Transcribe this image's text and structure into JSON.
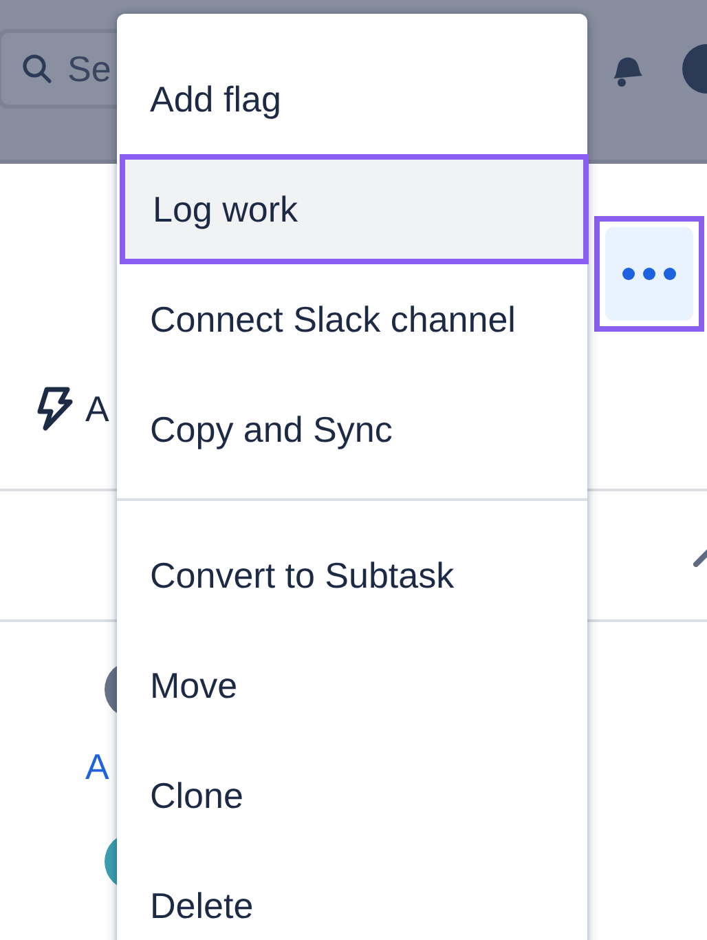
{
  "header": {
    "search": {
      "placeholder": "Se"
    }
  },
  "more_button": {
    "highlighted": true
  },
  "field_row": {
    "label": "A"
  },
  "activity": [
    {
      "color": "#687388"
    },
    {
      "color": "#3f9fb3"
    }
  ],
  "activity_link": "A",
  "menu": {
    "groups": [
      [
        {
          "label": "Add flag",
          "highlighted": false
        },
        {
          "label": "Log work",
          "highlighted": true
        },
        {
          "label": "Connect Slack channel",
          "highlighted": false
        },
        {
          "label": "Copy and Sync",
          "highlighted": false
        }
      ],
      [
        {
          "label": "Convert to Subtask",
          "highlighted": false
        },
        {
          "label": "Move",
          "highlighted": false
        },
        {
          "label": "Clone",
          "highlighted": false
        },
        {
          "label": "Delete",
          "highlighted": false
        }
      ]
    ]
  }
}
